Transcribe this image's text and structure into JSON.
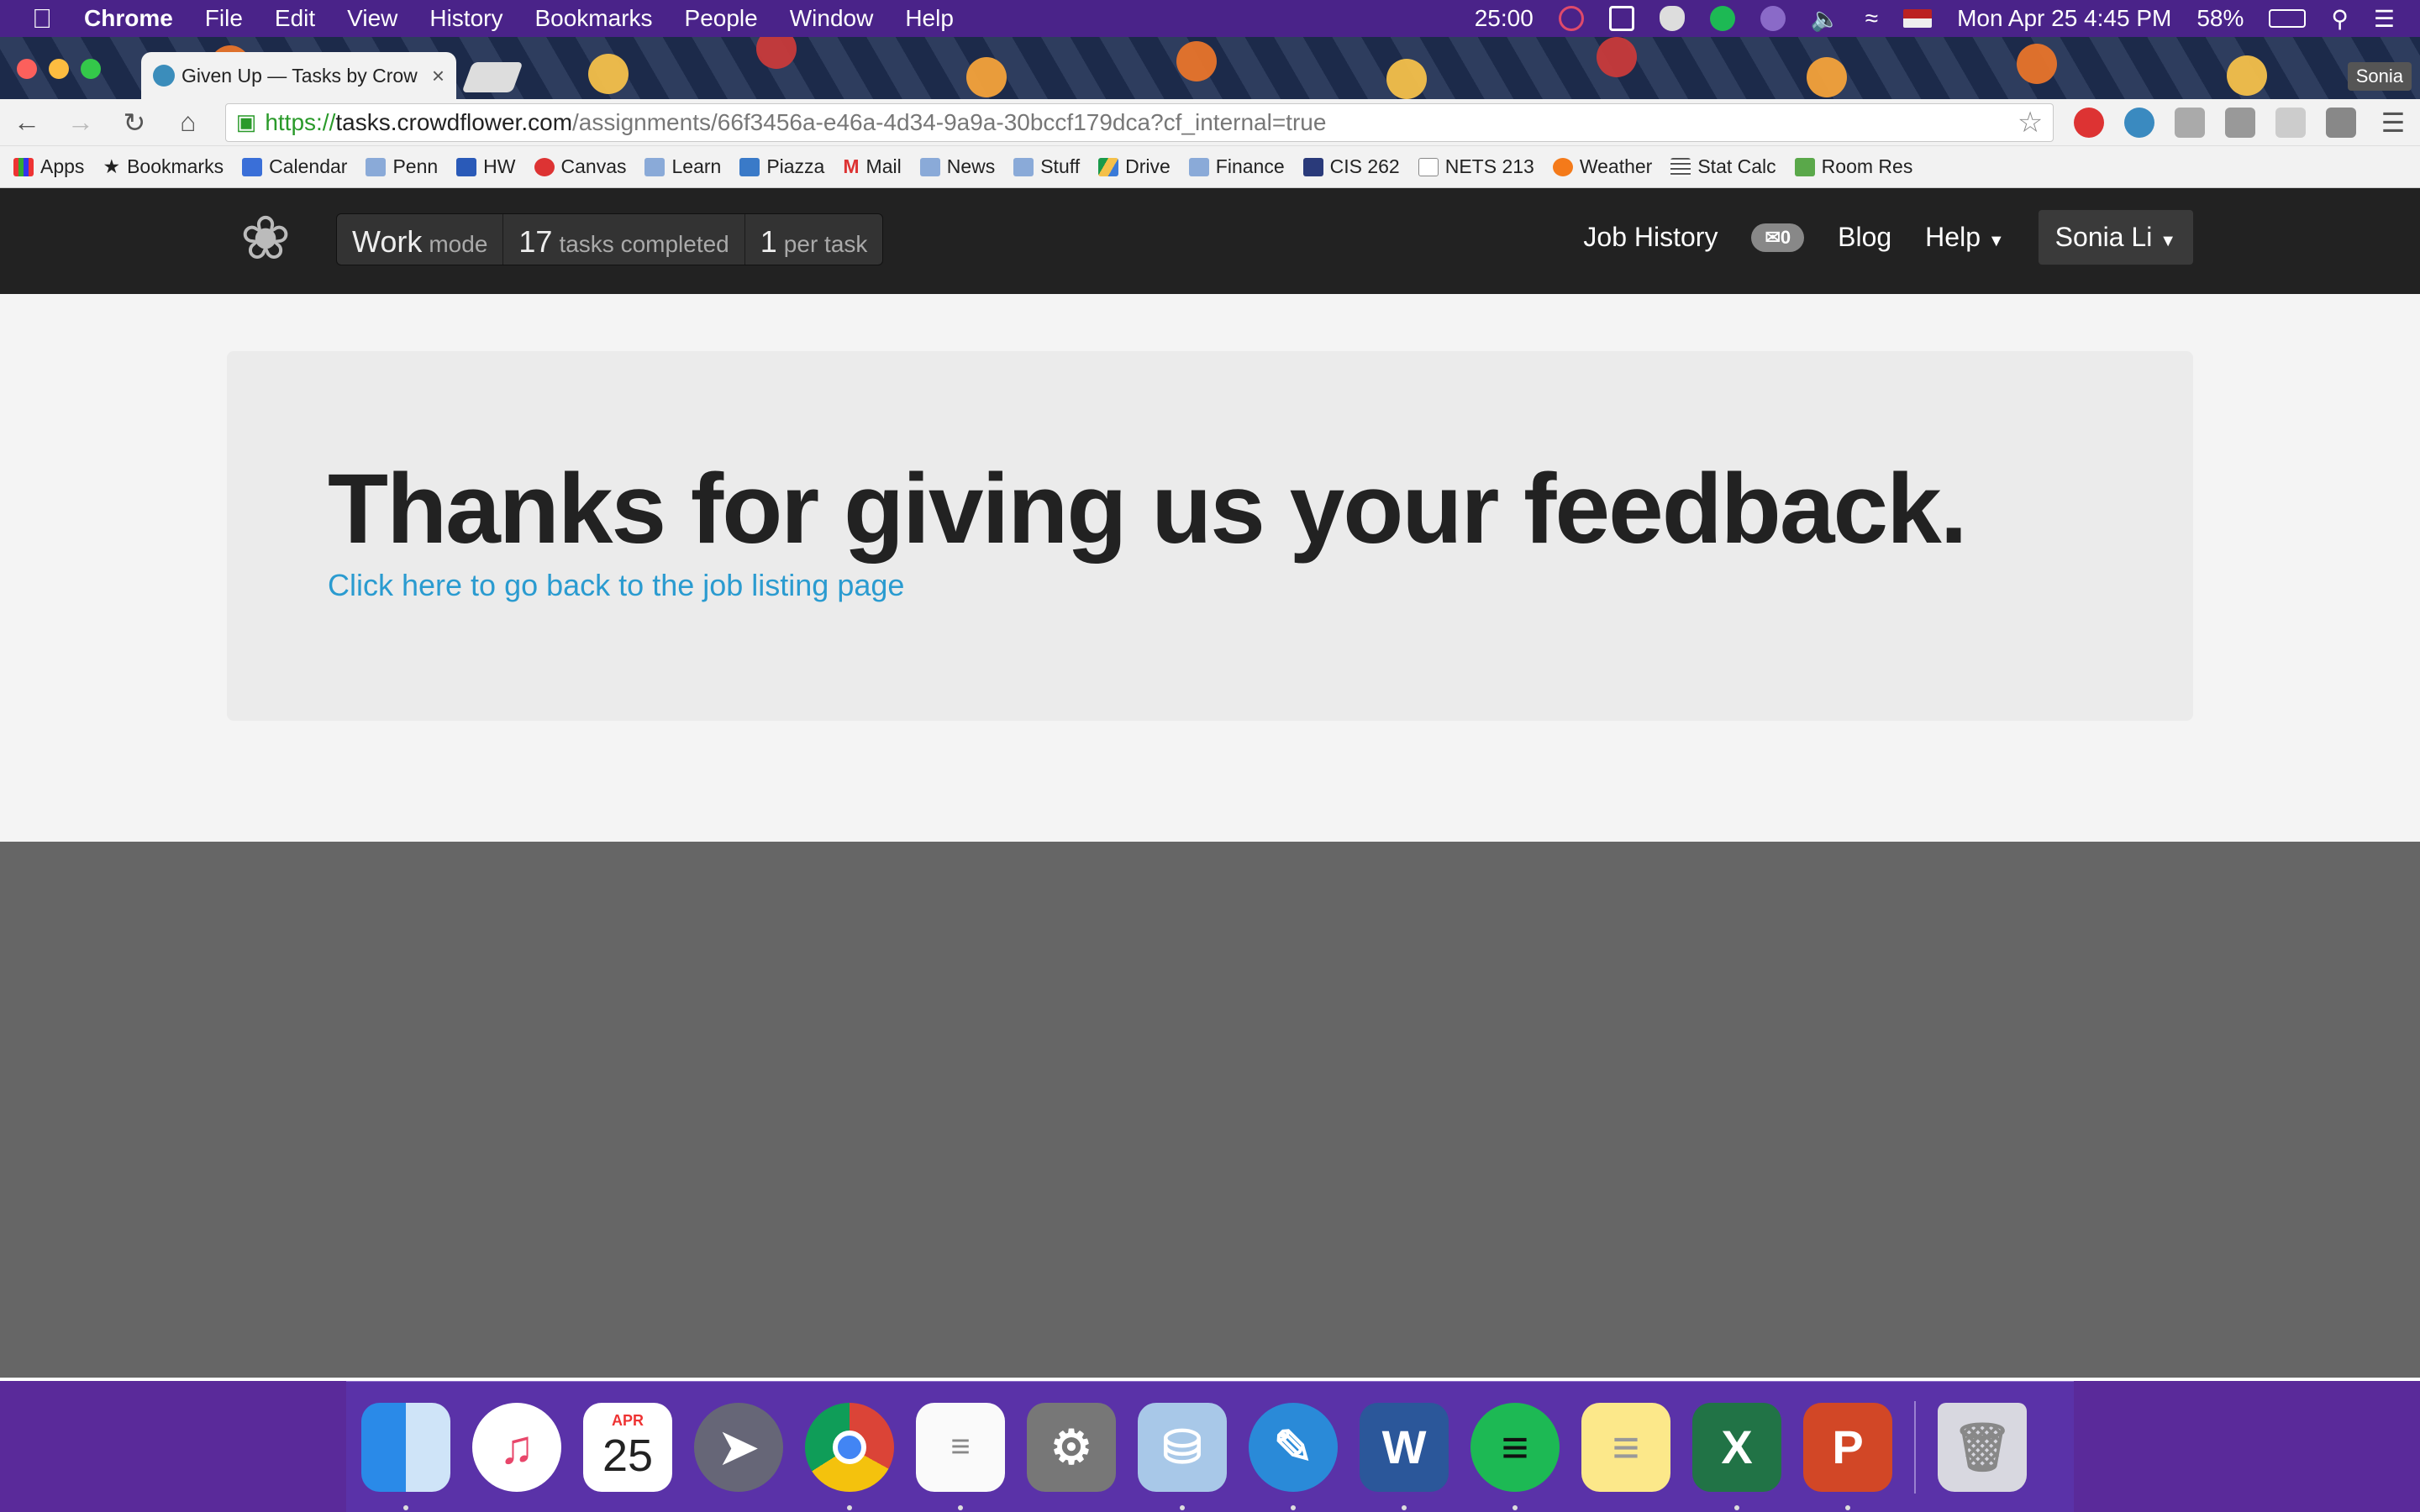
{
  "menubar": {
    "app_name": "Chrome",
    "items": [
      "File",
      "Edit",
      "View",
      "History",
      "Bookmarks",
      "People",
      "Window",
      "Help"
    ],
    "timer": "25:00",
    "datetime": "Mon Apr 25  4:45 PM",
    "battery": "58%"
  },
  "browser": {
    "tab_title": "Given Up — Tasks by Crow",
    "profile_name": "Sonia",
    "url_scheme": "https://",
    "url_host": "tasks.crowdflower.com",
    "url_path": "/assignments/66f3456a-e46a-4d34-9a9a-30bccf179dca?cf_internal=true",
    "bookmarks": [
      "Apps",
      "Bookmarks",
      "Calendar",
      "Penn",
      "HW",
      "Canvas",
      "Learn",
      "Piazza",
      "Mail",
      "News",
      "Stuff",
      "Drive",
      "Finance",
      "CIS 262",
      "NETS 213",
      "Weather",
      "Stat Calc",
      "Room Res"
    ]
  },
  "site": {
    "mode_big": "Work",
    "mode_small": "mode",
    "tasks_count": "17",
    "tasks_label": "tasks completed",
    "per_task_count": "1",
    "per_task_label": "per task",
    "nav_job_history": "Job History",
    "nav_messages_count": "0",
    "nav_blog": "Blog",
    "nav_help": "Help",
    "nav_user": "Sonia Li"
  },
  "main": {
    "headline": "Thanks for giving us your feedback.",
    "back_link": "Click here to go back to the job listing page"
  },
  "dock": {
    "apr_label": "APR",
    "day": "25",
    "apps": [
      "Finder",
      "iTunes",
      "Calendar",
      "Launchpad",
      "Chrome",
      "Reminders",
      "System Preferences",
      "Preview",
      "Pencil",
      "Word",
      "Spotify",
      "Notes",
      "Excel",
      "PowerPoint",
      "Trash"
    ]
  },
  "colors": {
    "accent_link": "#2a9bd0",
    "header_bg": "#222222",
    "menubar_bg": "#4a2389"
  }
}
